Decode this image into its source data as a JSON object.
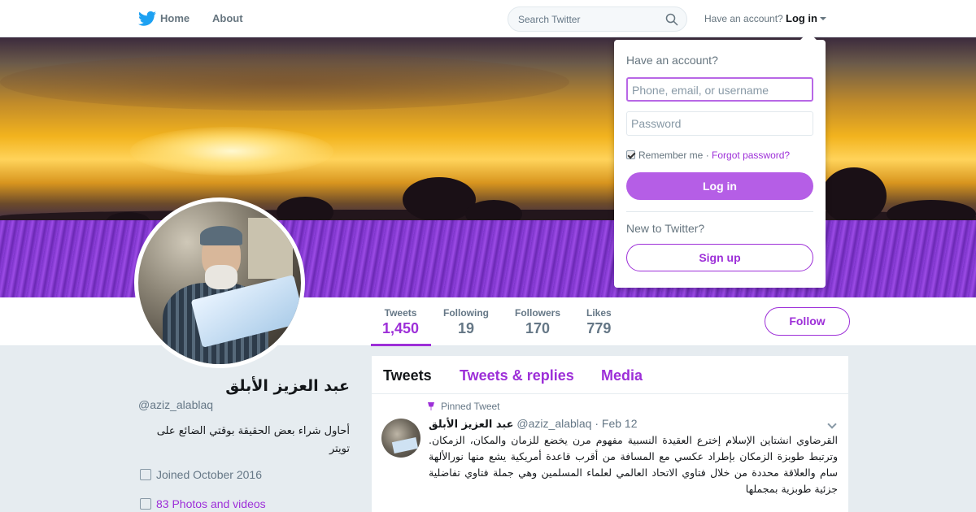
{
  "nav": {
    "home_label": "Home",
    "about_label": "About",
    "search_placeholder": "Search Twitter",
    "have_account": "Have an account?",
    "login_label": "Log in"
  },
  "profile": {
    "name": "عبد العزيز الأبلق",
    "handle": "@aziz_alablaq",
    "bio": "أحاول شراء بعض الحقيقة بوقتي الضائع على تويتر",
    "joined": "Joined October 2016",
    "photos": "83 Photos and videos"
  },
  "stats": [
    {
      "label": "Tweets",
      "value": "1,450"
    },
    {
      "label": "Following",
      "value": "19"
    },
    {
      "label": "Followers",
      "value": "170"
    },
    {
      "label": "Likes",
      "value": "779"
    }
  ],
  "follow_label": "Follow",
  "timeline": {
    "tabs": [
      "Tweets",
      "Tweets & replies",
      "Media"
    ],
    "pinned_label": "Pinned Tweet",
    "tweet": {
      "name": "عبد العزيز الأبلق",
      "handle": "@aziz_alablaq",
      "date": "· Feb 12",
      "text": "القرضاوي انشتاين الإسلام إخترع العقيدة النسبية مفهوم مرن يخضع للزمان والمكان، الزمكان. وترتبط طوبزة الزمكان بإطراد عكسي مع المسافة من أقرب قاعدة أمريكية يشع منها نورالألهة سام والعلاقة محددة من خلال فتاوي الاتحاد العالمي لعلماء المسلمين وهي جملة فتاوي تفاضلية جزئية طوبزية بمجملها"
    }
  },
  "login_dropdown": {
    "title": "Have an account?",
    "username_placeholder": "Phone, email, or username",
    "password_placeholder": "Password",
    "remember": "Remember me",
    "separator": "·",
    "forgot": "Forgot password?",
    "login_button": "Log in",
    "new_prompt": "New to Twitter?",
    "signup_button": "Sign up"
  },
  "colors": {
    "accent": "#9d2fd8",
    "login_button": "#b55ee6",
    "twitter_blue": "#1da1f2"
  }
}
